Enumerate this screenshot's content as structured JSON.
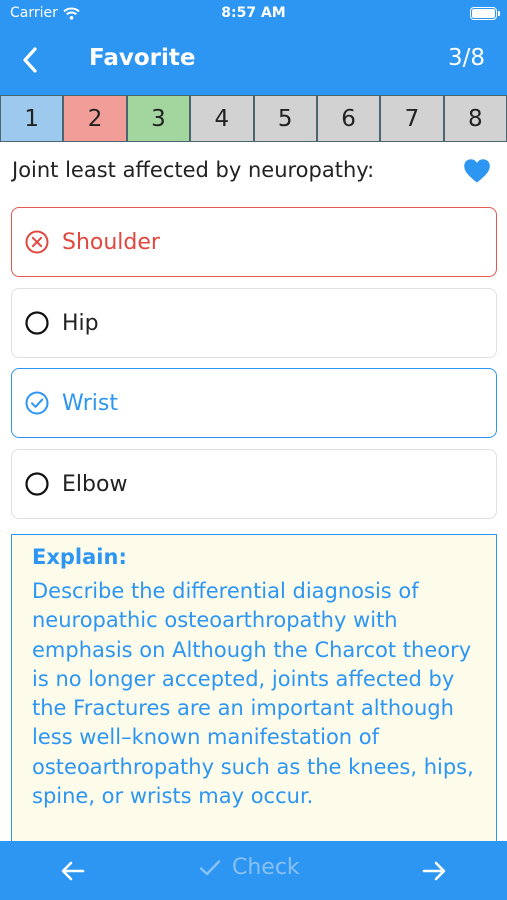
{
  "status_bar": {
    "carrier": "Carrier",
    "time": "8:57 AM"
  },
  "nav": {
    "title": "Favorite",
    "count": "3/8"
  },
  "tabs": [
    {
      "label": "1",
      "color": "#9dc9ee"
    },
    {
      "label": "2",
      "color": "#f29e98"
    },
    {
      "label": "3",
      "color": "#a3d59e"
    },
    {
      "label": "4",
      "color": "#d2d2d2"
    },
    {
      "label": "5",
      "color": "#d2d2d2"
    },
    {
      "label": "6",
      "color": "#d2d2d2"
    },
    {
      "label": "7",
      "color": "#d2d2d2"
    },
    {
      "label": "8",
      "color": "#d2d2d2"
    }
  ],
  "question": {
    "text": "Joint least affected by neuropathy:",
    "favorite_icon": "heart-icon"
  },
  "options": [
    {
      "label": "Shoulder",
      "state": "wrong",
      "icon": "x-circle-icon"
    },
    {
      "label": "Hip",
      "state": "unselected",
      "icon": "radio-empty-icon"
    },
    {
      "label": "Wrist",
      "state": "correct",
      "icon": "check-circle-icon"
    },
    {
      "label": "Elbow",
      "state": "unselected",
      "icon": "radio-empty-icon"
    }
  ],
  "explain": {
    "title": "Explain:",
    "text": "Describe the differential diagnosis of neuropathic osteoarthropathy with emphasis on Although the Charcot theory is no longer accepted, joints affected by the Fractures are an important although less well–known manifestation of osteoarthropathy such as the knees, hips, spine, or wrists may occur."
  },
  "bottom_bar": {
    "check_label": "Check"
  },
  "colors": {
    "accent": "#2c96f2",
    "wrong": "#e0483f",
    "explain_bg": "#fdfbea"
  }
}
